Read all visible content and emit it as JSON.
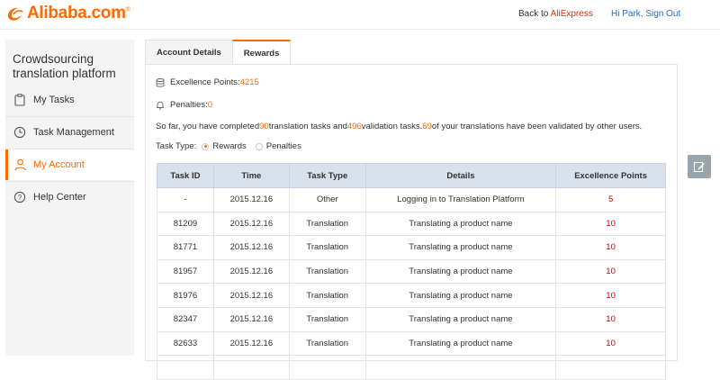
{
  "header": {
    "logo_text": "Alibaba.com",
    "logo_reg": "®",
    "back_prefix": "Back to ",
    "back_brand": "AliExpress",
    "greeting": "Hi Park, ",
    "sign_out": "Sign Out"
  },
  "sidebar": {
    "title": "Crowdsourcing translation platform",
    "items": [
      {
        "label": "My Tasks",
        "icon": "clipboard-icon"
      },
      {
        "label": "Task Management",
        "icon": "clock-icon"
      },
      {
        "label": "My Account",
        "icon": "user-icon"
      },
      {
        "label": "Help Center",
        "icon": "question-icon"
      }
    ],
    "active_index": 2
  },
  "tabs": [
    {
      "label": "Account Details"
    },
    {
      "label": "Rewards"
    }
  ],
  "rewards": {
    "points_label": "Excellence Points: ",
    "points_value": "4215",
    "penalties_label": "Penalties: ",
    "penalties_value": "0",
    "summary_a": "So far, you have completed ",
    "translation_count": "90",
    "summary_b": " translation tasks and ",
    "validation_count": "496",
    "summary_c": " validation tasks. ",
    "validated_count": "69",
    "summary_d": " of your translations have been validated by other users.",
    "task_type_label": "Task Type:",
    "option_rewards": "Rewards",
    "option_penalties": "Penalties",
    "selected_option": "Rewards"
  },
  "table": {
    "headers": [
      "Task ID",
      "Time",
      "Task Type",
      "Details",
      "Excellence Points"
    ],
    "rows": [
      [
        "-",
        "2015.12.16",
        "Other",
        "Logging in to Translation Platform",
        "5"
      ],
      [
        "81209",
        "2015.12.16",
        "Translation",
        "Translating a product name",
        "10"
      ],
      [
        "81771",
        "2015.12.16",
        "Translation",
        "Translating a product name",
        "10"
      ],
      [
        "81957",
        "2015.12.16",
        "Translation",
        "Translating a product name",
        "10"
      ],
      [
        "81976",
        "2015.12.16",
        "Translation",
        "Translating a product name",
        "10"
      ],
      [
        "82347",
        "2015.12.16",
        "Translation",
        "Translating a product name",
        "10"
      ],
      [
        "82633",
        "2015.12.16",
        "Translation",
        "Translating a product name",
        "10"
      ],
      [
        "",
        "",
        "",
        "",
        ""
      ]
    ]
  },
  "colors": {
    "accent": "#ff6a00",
    "points_red": "#cc0000",
    "link_blue": "#2a6dbb",
    "header_bg": "#d9e1ec"
  }
}
